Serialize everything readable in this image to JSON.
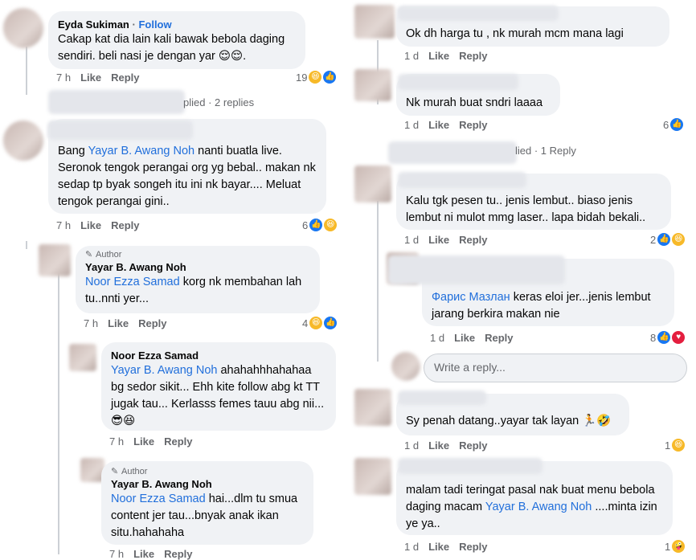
{
  "left": {
    "c1": {
      "name": "Eyda Sukiman",
      "follow": "Follow",
      "text": "Cakap kat dia lain kali bawak bebola daging sendiri. beli nasi je dengan yar 😌😌.",
      "time": "7 h",
      "like": "Like",
      "reply": "Reply",
      "count": "19"
    },
    "c1_replies": "plied · 2 replies",
    "c2": {
      "pre": "Bang ",
      "mention": "Yayar B. Awang Noh",
      "text": " nanti buatla live. Seronok tengok perangai org yg bebal.. makan nk sedap tp byak songeh itu ini nk bayar.... Meluat tengok perangai gini..",
      "time": "7 h",
      "like": "Like",
      "reply": "Reply",
      "count": "6"
    },
    "c3": {
      "author": "Author",
      "name": "Yayar B. Awang Noh",
      "mention": "Noor Ezza Samad",
      "text": " korg nk membahan lah tu..nnti yer...",
      "time": "7 h",
      "like": "Like",
      "reply": "Reply",
      "count": "4"
    },
    "c4": {
      "name": "Noor Ezza Samad",
      "mention": "Yayar B. Awang Noh",
      "text": " ahahahhhahahaa bg sedor sikit... Ehh kite follow abg kt TT jugak tau... Kerlasss femes tauu abg nii... 😎😆",
      "time": "7 h",
      "like": "Like",
      "reply": "Reply"
    },
    "c5": {
      "author": "Author",
      "name": "Yayar B. Awang Noh",
      "mention": "Noor Ezza Samad",
      "text": " hai...dlm tu smua content jer tau...bnyak anak ikan situ.hahahaha",
      "time": "7 h",
      "like": "Like",
      "reply": "Reply"
    }
  },
  "right": {
    "c1": {
      "text": "Ok dh harga tu , nk murah mcm mana lagi",
      "time": "1 d",
      "like": "Like",
      "reply": "Reply"
    },
    "c2": {
      "text": "Nk murah buat sndri laaaa",
      "time": "1 d",
      "like": "Like",
      "reply": "Reply",
      "count": "6"
    },
    "c2_replies": "lied · 1 Reply",
    "c3": {
      "text": "Kalu tgk pesen tu.. jenis lembut.. biaso jenis lembut ni mulot mmg laser.. lapa bidah bekali..",
      "time": "1 d",
      "like": "Like",
      "reply": "Reply",
      "count": "2"
    },
    "c4": {
      "mention": "Фарис Мазлан",
      "text": " keras eloi jer...jenis lembut jarang berkira makan nie",
      "time": "1 d",
      "like": "Like",
      "reply": "Reply",
      "count": "8"
    },
    "reply_placeholder": "Write a reply...",
    "c5": {
      "text": "Sy penah datang..yayar tak layan 🏃🤣",
      "time": "1 d",
      "like": "Like",
      "reply": "Reply",
      "count": "1"
    },
    "c6": {
      "pre": "malam tadi teringat pasal nak buat menu bebola daging macam ",
      "mention": "Yayar B. Awang Noh",
      "text": " ....minta izin ye ya..",
      "time": "1 d",
      "like": "Like",
      "reply": "Reply",
      "count": "1"
    }
  },
  "icons": {
    "like": "like-reaction-icon",
    "haha": "haha-reaction-icon",
    "love": "love-reaction-icon",
    "pen": "pen-icon"
  },
  "colors": {
    "mention": "#216fdb",
    "bubble": "#f0f2f5",
    "meta": "#65676b"
  }
}
